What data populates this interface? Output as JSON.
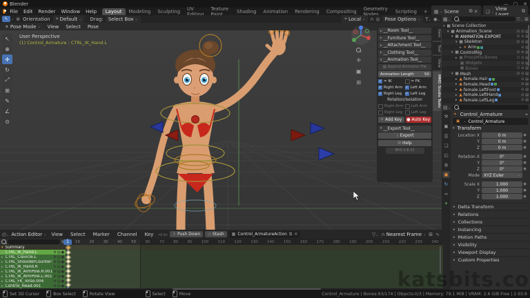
{
  "window": {
    "app_title": "Blender"
  },
  "topbar": {
    "menus": [
      "File",
      "Edit",
      "Render",
      "Window",
      "Help"
    ],
    "workspaces": [
      "Layout",
      "Modeling",
      "Sculpting",
      "UV Editing",
      "Texture Paint",
      "Shading",
      "Animation",
      "Rendering",
      "Compositing",
      "Geometry Nodes",
      "Scripting"
    ],
    "new_tab": "+",
    "scene_label": "Scene",
    "view_layer_label": "View Layer"
  },
  "tool_settings": {
    "orientation_label": "Orientation",
    "orientation_value": "Default",
    "drag_label": "Drag:",
    "drag_value": "Select Box",
    "pivot_value": "Local",
    "pose_options_label": "Pose Options"
  },
  "viewport": {
    "mode": "Pose Mode",
    "menu_view": "View",
    "menu_select": "Select",
    "menu_pose": "Pose",
    "overlay_line1": "User Perspective",
    "overlay_line2": "(1) Control_Armature : CTRL_IK_Hand.L"
  },
  "npanel": {
    "tabs": [
      "Item",
      "Tool",
      "View",
      "MMD Studio Tools"
    ],
    "sections": {
      "room": "__Room Tool__",
      "furniture": "__Furniture Tool__",
      "attachment": "__Attachment Tool__",
      "clothing": "__Clothing Tool__",
      "animation": "__Animation Tool__",
      "export": "__Export Tool__"
    },
    "animation": {
      "append_button": "Append Animation File",
      "length_label": "Animation Length",
      "length_value": "50",
      "ik": "= IK",
      "fk": "= FK",
      "right_arm": "Right Arm",
      "left_arm": "Left Arm",
      "right_leg": "Right Leg",
      "left_leg": "Left Leg",
      "rotation_header": "Rotation/Isolation",
      "add_key": "Add Key",
      "auto_key": "Auto Key"
    },
    "export": {
      "export_button": "Export",
      "help_button": "Help",
      "version_button": "BHS 0.8.32"
    }
  },
  "outliner": {
    "rows": [
      {
        "label": "Scene Collection"
      },
      {
        "label": "Animation_Scene"
      },
      {
        "label": "ANIMATION-EXPORT"
      },
      {
        "label": "Skeleton"
      },
      {
        "label": "Arm"
      },
      {
        "label": "ControlRig"
      },
      {
        "label": "ProxyMiscBones"
      },
      {
        "label": "Widgets"
      },
      {
        "label": "Bones"
      },
      {
        "label": "Mesh"
      },
      {
        "label": "female.Hair"
      },
      {
        "label": "female.Head"
      },
      {
        "label": "female.LeftFoot"
      },
      {
        "label": "female.LeftHand"
      },
      {
        "label": "female.LeftLeg"
      }
    ]
  },
  "properties": {
    "breadcrumb": "Control_Armature",
    "object_name": "Control_Armature",
    "transform_header": "Transform",
    "rows": [
      {
        "label": "Location X",
        "value": "0 m"
      },
      {
        "label": "Y",
        "value": "0 m"
      },
      {
        "label": "Z",
        "value": "0 m"
      },
      {
        "label": "Rotation X",
        "value": "0°"
      },
      {
        "label": "Y",
        "value": "0°"
      },
      {
        "label": "Z",
        "value": "0°"
      }
    ],
    "mode_label": "Mode",
    "mode_value": "XYZ Euler",
    "scale_rows": [
      {
        "label": "Scale X",
        "value": "1.000"
      },
      {
        "label": "Y",
        "value": "1.000"
      },
      {
        "label": "Z",
        "value": "1.000"
      }
    ],
    "sections": [
      "Delta Transform",
      "Relations",
      "Collections",
      "Instancing",
      "Motion Paths",
      "Visibility",
      "Viewport Display",
      "Custom Properties"
    ]
  },
  "dopesheet": {
    "editor_label": "Action Editor",
    "menus": [
      "View",
      "Select",
      "Marker",
      "Channel",
      "Key"
    ],
    "push_down": "Push Down",
    "stash": "Stash",
    "action_name": "Control_ArmatureAction",
    "snap_value": "Nearest Frame",
    "current_frame": "1",
    "ruler": [
      "10",
      "20",
      "30",
      "40",
      "50",
      "60",
      "70",
      "80",
      "90",
      "100",
      "110",
      "120",
      "130",
      "140",
      "150",
      "160",
      "170",
      "180",
      "190",
      "200",
      "210",
      "220",
      "230",
      "240"
    ],
    "channels": [
      {
        "label": "Summary"
      },
      {
        "label": "CTRL_IK_Hand.L"
      },
      {
        "label": "CTRL_Clavicle.L"
      },
      {
        "label": "CTRL_ShoulderCounterTw"
      },
      {
        "label": "CTRL_IK_Hand.R"
      },
      {
        "label": "CTRL_IK_ArmPole.R.001"
      },
      {
        "label": "CTRL_IK_ArmPole.L.001"
      },
      {
        "label": "CTRL_FK_Torso.004"
      },
      {
        "label": "Control_Head.001"
      }
    ]
  },
  "statusbar": {
    "hints": [
      "Set 3D Cursor",
      "Box Select",
      "Rotate View",
      "Select",
      "Move"
    ],
    "stats": "Control_Armature | Bones:93/174 | Objects:0/3 | Memory: 79.1 MiB | VRAM: 2.6 GiB Free | 2.93.6"
  },
  "watermark": "katsbits.com",
  "colors": {
    "accent": "#4772b3",
    "autokey": "#b02e2e",
    "active_channel": "#63a844",
    "skin": "#d99d6f",
    "bikini": "#c8281c"
  }
}
